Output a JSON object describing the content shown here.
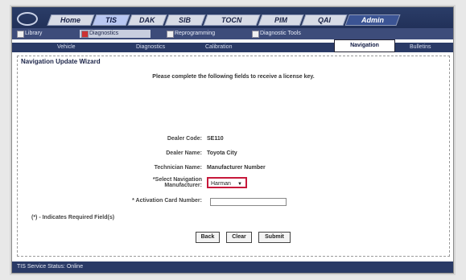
{
  "tabs": [
    "Home",
    "TIS",
    "DAK",
    "SIB",
    "TOCN",
    "PIM",
    "QAI",
    "Admin"
  ],
  "subtabs": [
    "Library",
    "Diagnostics",
    "Reprogramming",
    "Diagnostic Tools"
  ],
  "thirdtabs": [
    "Vehicle",
    "Diagnostics",
    "Calibration",
    "Navigation",
    "Bulletins"
  ],
  "wizard": {
    "title": "Navigation Update Wizard",
    "instruction": "Please complete the following fields to receive a license key.",
    "dealer_code_label": "Dealer Code:",
    "dealer_code_value": "SE110",
    "dealer_name_label": "Dealer Name:",
    "dealer_name_value": "Toyota City",
    "technician_name_label": "Technician Name:",
    "technician_name_value": "Manufacturer Number",
    "manufacturer_label_line1": "*Select Navigation",
    "manufacturer_label_line2": "Manufacturer:",
    "manufacturer_value": "Harman",
    "activation_label": "* Activation Card Number:",
    "activation_value": "",
    "required_note": "(*) - Indicates Required Field(s)",
    "buttons": [
      "Back",
      "Clear",
      "Submit"
    ]
  },
  "statusbar": "TIS Service Status: Online",
  "colors": {
    "accent": "#c7193b",
    "nav": "#2a3a66"
  }
}
